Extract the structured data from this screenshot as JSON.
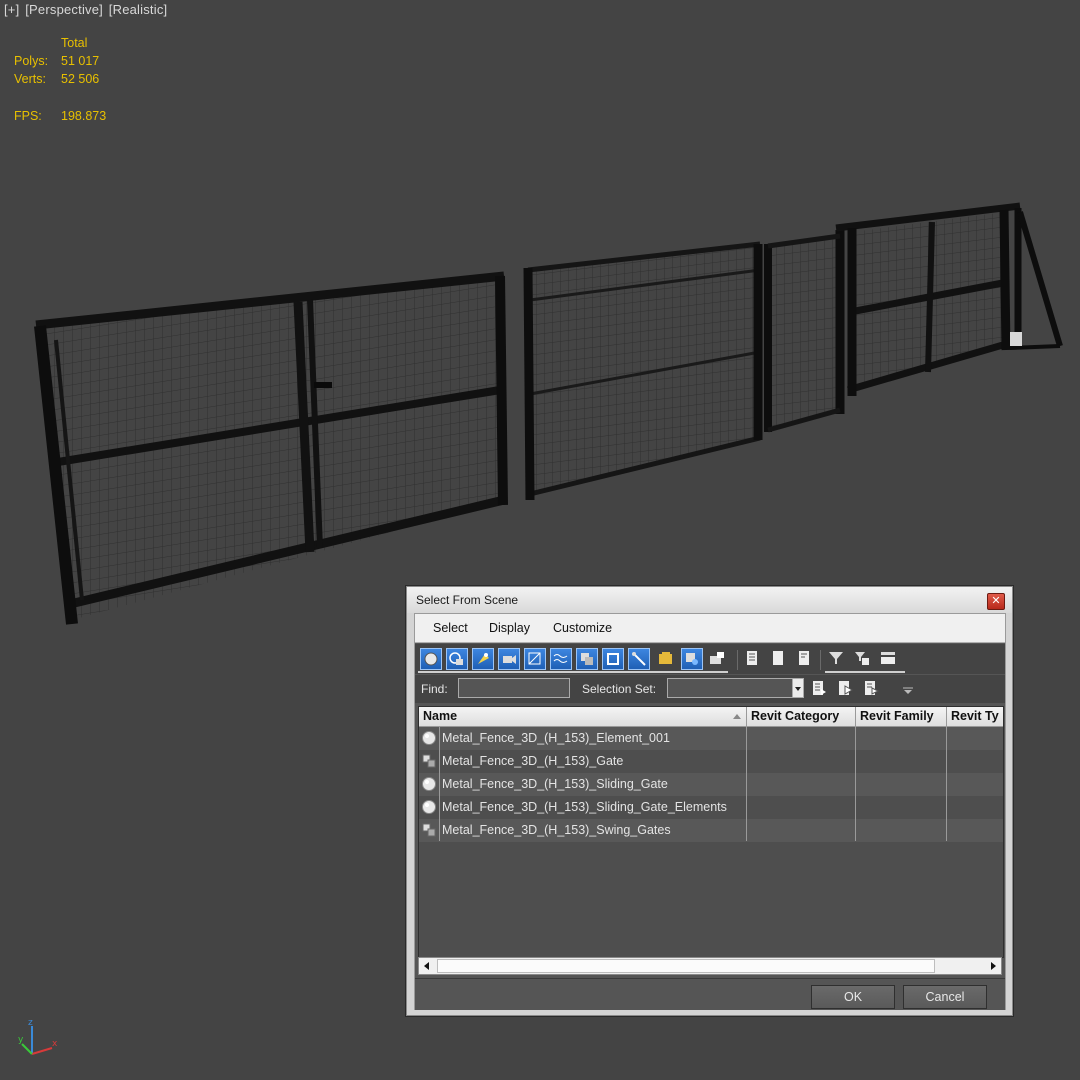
{
  "viewport": {
    "label_plus": "[+]",
    "label_view": "[Perspective]",
    "label_shading": "[Realistic]",
    "stats": {
      "total_header": "Total",
      "polys_label": "Polys:",
      "polys_value": "51 017",
      "verts_label": "Verts:",
      "verts_value": "52 506",
      "fps_label": "FPS:",
      "fps_value": "198.873"
    },
    "axis": {
      "z": "z",
      "x": "x",
      "y": "y"
    }
  },
  "dialog": {
    "title": "Select From Scene",
    "close_icon": "close-icon",
    "menu": [
      "Select",
      "Display",
      "Customize"
    ],
    "toolbar_icons": [
      "display-geometry-icon",
      "display-shapes-icon",
      "display-lights-icon",
      "display-cameras-icon",
      "display-helpers-icon",
      "display-spacewarps-icon",
      "display-groups-icon",
      "display-xrefs-icon",
      "display-bones-icon",
      "display-containers-icon",
      "display-frozen-icon",
      "display-hidden-icon",
      "select-all-icon",
      "select-none-icon",
      "select-invert-icon",
      "filter-icon",
      "filter-selected-icon",
      "columns-icon"
    ],
    "find_label": "Find:",
    "find_value": "",
    "selection_set_label": "Selection Set:",
    "selection_set_value": "",
    "columns": [
      "Name",
      "Revit Category",
      "Revit Family",
      "Revit Ty"
    ],
    "rows": [
      {
        "name": "Metal_Fence_3D_(H_153)_Element_001",
        "icon": "geometry-sphere-icon"
      },
      {
        "name": "Metal_Fence_3D_(H_153)_Gate",
        "icon": "group-icon"
      },
      {
        "name": "Metal_Fence_3D_(H_153)_Sliding_Gate",
        "icon": "geometry-sphere-icon"
      },
      {
        "name": "Metal_Fence_3D_(H_153)_Sliding_Gate_Elements",
        "icon": "geometry-sphere-icon"
      },
      {
        "name": "Metal_Fence_3D_(H_153)_Swing_Gates",
        "icon": "group-icon"
      }
    ],
    "ok_label": "OK",
    "cancel_label": "Cancel"
  },
  "colors": {
    "viewport_bg": "#444444",
    "stats_text": "#e8c000",
    "toolbar_active": "#2a6fc9",
    "fence": "#1a1a1a"
  }
}
